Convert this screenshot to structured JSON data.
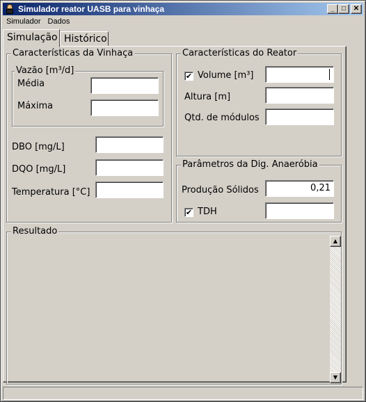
{
  "window": {
    "title": "Simulador reator UASB para vinhaça"
  },
  "menu": {
    "items": [
      "Simulador",
      "Dados"
    ]
  },
  "tabs": {
    "simulacao": "Simulação",
    "historico": "Histórico"
  },
  "vinhaca": {
    "title": "Características da Vinhaça",
    "vazao": {
      "title": "Vazão [m³/d]",
      "media_label": "Média",
      "media_value": "",
      "maxima_label": "Máxima",
      "maxima_value": ""
    },
    "dbo_label": "DBO [mg/L]",
    "dbo_value": "",
    "dqo_label": "DQO [mg/L]",
    "dqo_value": "",
    "temp_label": "Temperatura [°C]",
    "temp_value": ""
  },
  "reator": {
    "title": "Características do Reator",
    "volume_label": "Volume [m³]",
    "volume_checked": true,
    "volume_value": "",
    "altura_label": "Altura [m]",
    "altura_value": "",
    "modulos_label": "Qtd. de módulos",
    "modulos_value": ""
  },
  "parametros": {
    "title": "Parâmetros da Dig. Anaeróbia",
    "producao_label": "Produção Sólidos",
    "producao_value": "0,21",
    "tdh_label": "TDH",
    "tdh_checked": true,
    "tdh_value": ""
  },
  "resultado": {
    "title": "Resultado",
    "text": ""
  },
  "icons": {
    "check": "✔",
    "scroll_up": "▲",
    "scroll_down": "▼",
    "minimize": "_",
    "maximize": "□",
    "close": "✕"
  }
}
